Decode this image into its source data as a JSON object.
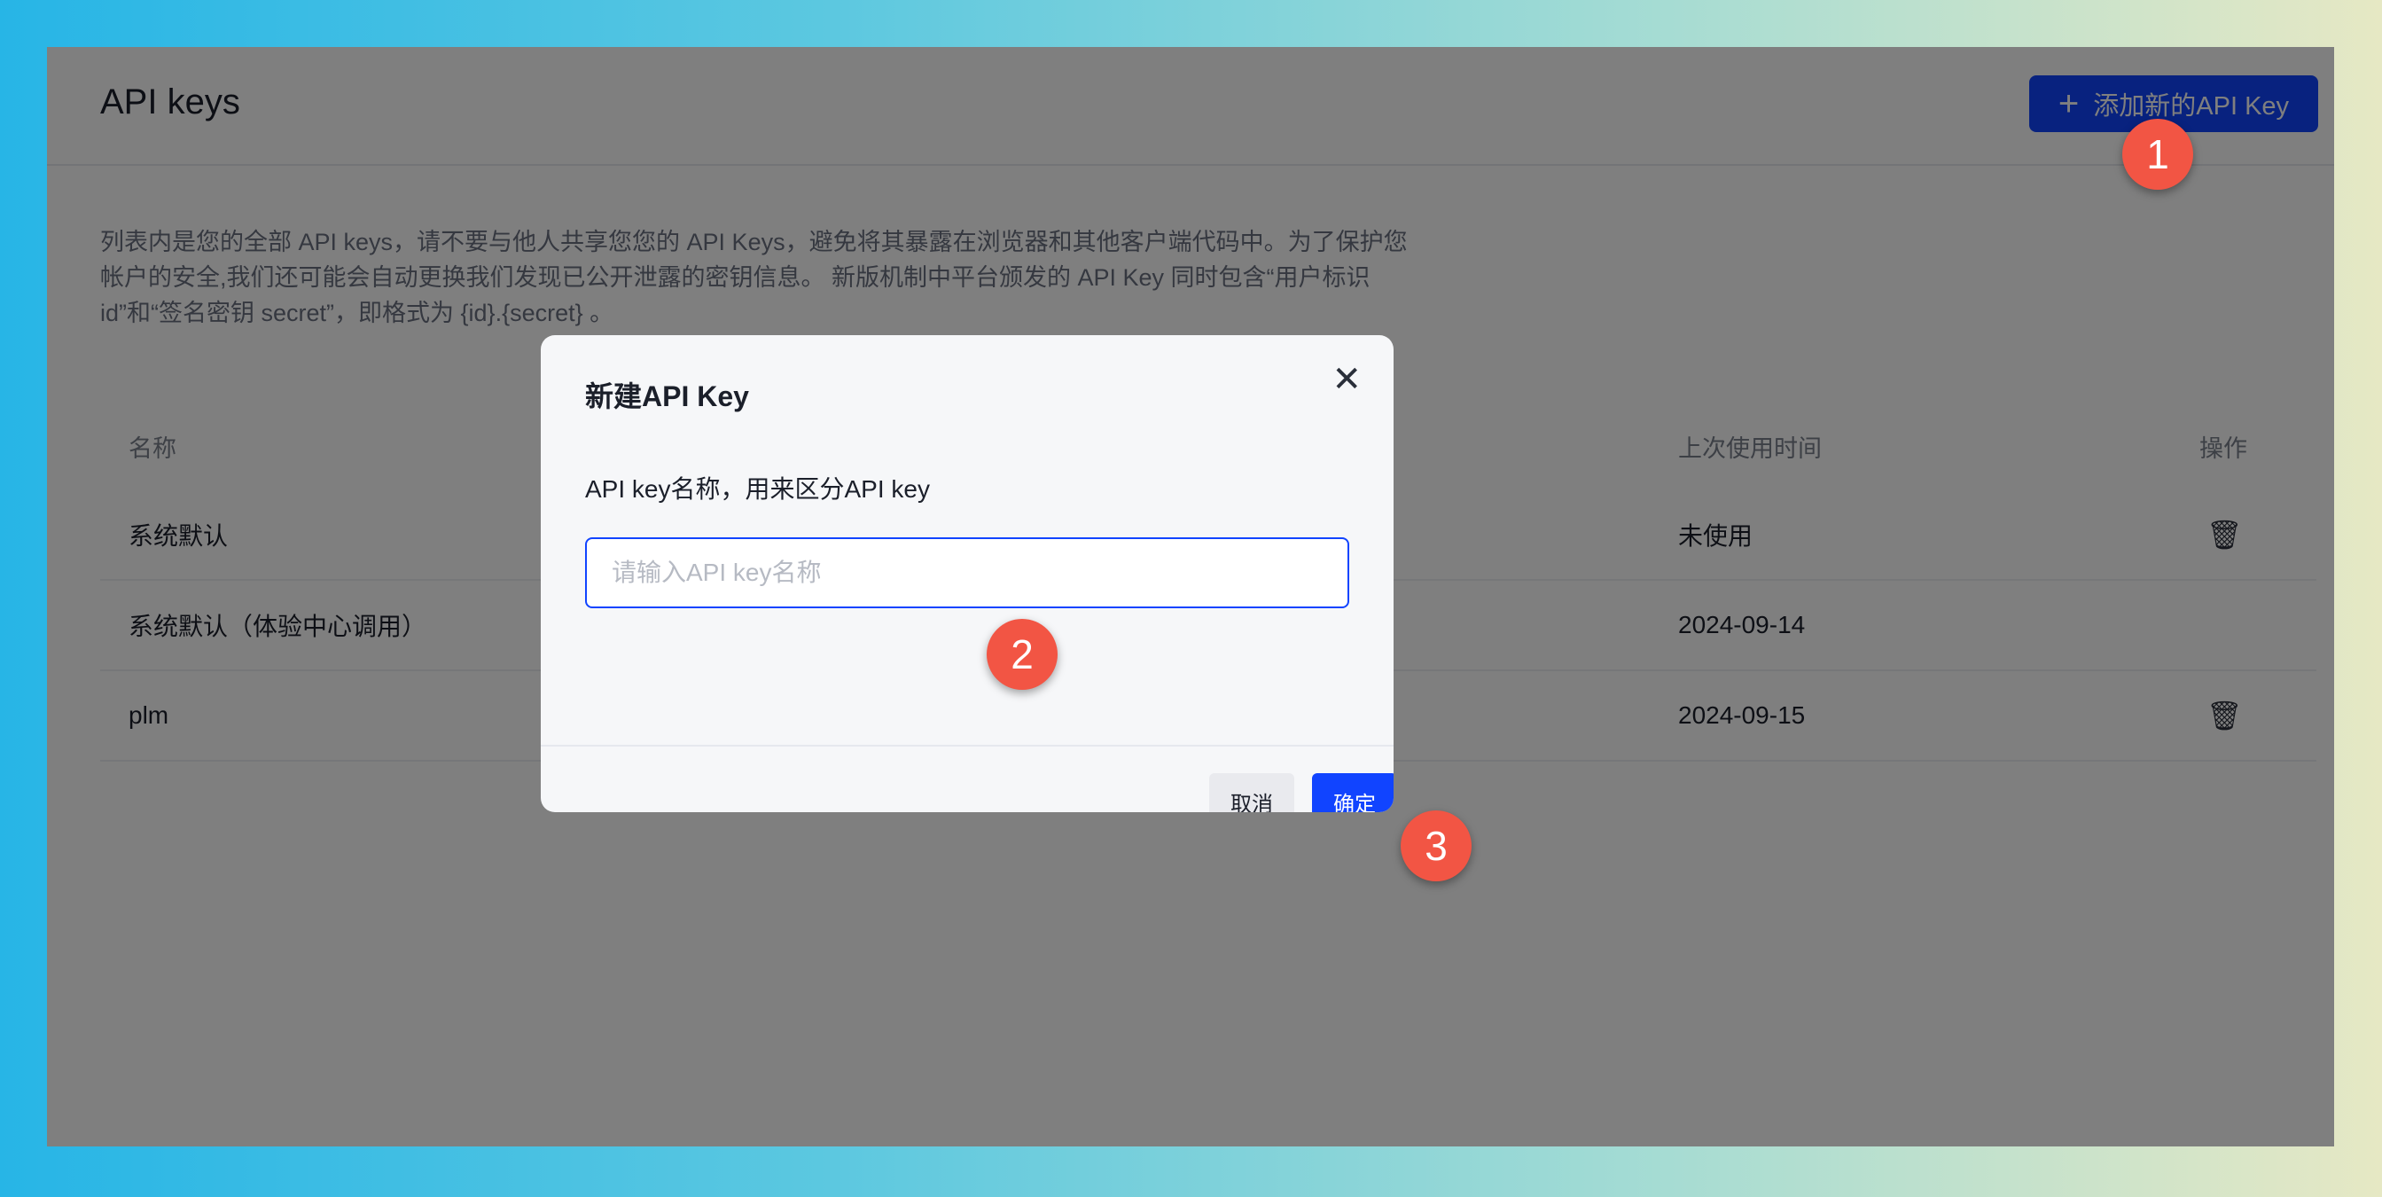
{
  "page": {
    "title": "API keys",
    "add_button_label": "添加新的API Key",
    "add_button_icon": "plus-icon",
    "description": "列表内是您的全部 API keys，请不要与他人共享您您的 API Keys，避免将其暴露在浏览器和其他客户端代码中。为了保护您帐户的安全,我们还可能会自动更换我们发现已公开泄露的密钥信息。 新版机制中平台颁发的 API Key 同时包含“用户标识 id”和“签名密钥 secret”，即格式为 {id}.{secret} 。"
  },
  "table": {
    "headers": {
      "name": "名称",
      "last_used": "上次使用时间",
      "actions": "操作"
    },
    "rows": [
      {
        "name": "系统默认",
        "last_used": "未使用",
        "action_icon": "trash-icon"
      },
      {
        "name": "系统默认（体验中心调用）",
        "last_used": "2024-09-14",
        "action_icon": ""
      },
      {
        "name": "plm",
        "last_used": "2024-09-15",
        "action_icon": "trash-icon"
      }
    ]
  },
  "modal": {
    "title": "新建API Key",
    "field_label": "API key名称，用来区分API key",
    "input_placeholder": "请输入API key名称",
    "input_value": "",
    "cancel_label": "取消",
    "confirm_label": "确定",
    "close_icon": "close-icon"
  },
  "steps": [
    "1",
    "2",
    "3"
  ],
  "colors": {
    "accent": "#1144ff",
    "step_marker": "#f25544",
    "overlay": "rgba(0,0,0,0.5)"
  }
}
